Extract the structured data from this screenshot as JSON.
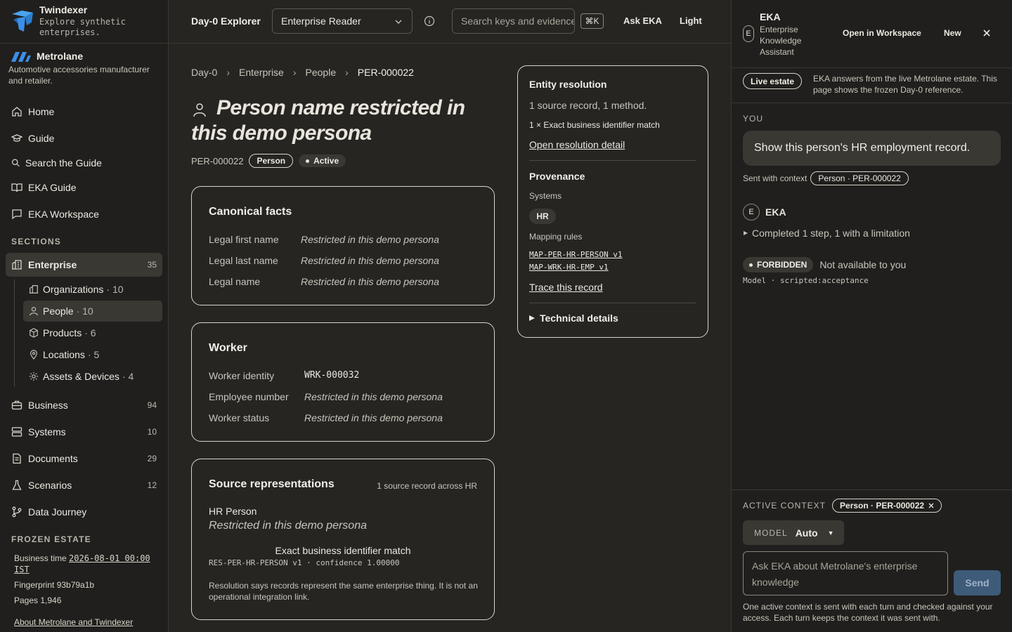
{
  "brand": {
    "name": "Twindexer",
    "tagline": "Explore synthetic enterprises."
  },
  "org": {
    "name": "Metrolane",
    "description": "Automotive accessories manufacturer and retailer."
  },
  "nav": {
    "home": "Home",
    "guide": "Guide",
    "search_guide": "Search the Guide",
    "eka_guide": "EKA Guide",
    "eka_workspace": "EKA Workspace"
  },
  "sections_heading": "SECTIONS",
  "sections": {
    "enterprise": {
      "label": "Enterprise",
      "count": "35"
    },
    "business": {
      "label": "Business",
      "count": "94"
    },
    "systems": {
      "label": "Systems",
      "count": "10"
    },
    "documents": {
      "label": "Documents",
      "count": "29"
    },
    "scenarios": {
      "label": "Scenarios",
      "count": "12"
    },
    "data_journey": {
      "label": "Data Journey"
    }
  },
  "enterprise_sub": [
    {
      "label": "Organizations",
      "count": "· 10"
    },
    {
      "label": "People",
      "count": "· 10"
    },
    {
      "label": "Products",
      "count": "· 6"
    },
    {
      "label": "Locations",
      "count": "· 5"
    },
    {
      "label": "Assets & Devices",
      "count": "· 4"
    }
  ],
  "frozen": {
    "heading": "FROZEN ESTATE",
    "business_time_label": "Business time",
    "business_time": "2026-08-01 00:00 IST",
    "fingerprint": "Fingerprint 93b79a1b",
    "pages": "Pages 1,946",
    "about": "About Metrolane and Twindexer"
  },
  "topbar": {
    "title": "Day-0 Explorer",
    "persona": "Enterprise Reader",
    "search_placeholder": "Search keys and evidence",
    "shortcut": "⌘K",
    "ask": "Ask EKA",
    "theme": "Light"
  },
  "breadcrumb": [
    "Day-0",
    "Enterprise",
    "People",
    "PER-000022"
  ],
  "entity": {
    "title": "Person name restricted in this demo persona",
    "id": "PER-000022",
    "type": "Person",
    "status": "Active"
  },
  "canonical": {
    "heading": "Canonical facts",
    "rows": [
      {
        "k": "Legal first name",
        "v": "Restricted in this demo persona"
      },
      {
        "k": "Legal last name",
        "v": "Restricted in this demo persona"
      },
      {
        "k": "Legal name",
        "v": "Restricted in this demo persona"
      }
    ]
  },
  "worker": {
    "heading": "Worker",
    "rows": [
      {
        "k": "Worker identity",
        "v": "WRK-000032"
      },
      {
        "k": "Employee number",
        "v": "Restricted in this demo persona"
      },
      {
        "k": "Worker status",
        "v": "Restricted in this demo persona"
      }
    ]
  },
  "sources": {
    "heading": "Source representations",
    "summary": "1 source record across HR",
    "system_label": "HR Person",
    "value": "Restricted in this demo persona",
    "match": "Exact business identifier match",
    "rule": "RES-PER-HR-PERSON v1 · confidence 1.00000",
    "note": "Resolution says records represent the same enterprise thing. It is not an operational integration link."
  },
  "resolution": {
    "heading": "Entity resolution",
    "summary": "1 source record, 1 method.",
    "method": "1 × Exact business identifier match",
    "link": "Open resolution detail"
  },
  "provenance": {
    "heading": "Provenance",
    "systems_label": "Systems",
    "system": "HR",
    "rules_label": "Mapping rules",
    "rules": [
      "MAP-PER-HR-PERSON v1",
      "MAP-WRK-HR-EMP v1"
    ],
    "trace": "Trace this record",
    "technical": "Technical details"
  },
  "eka": {
    "badge": "E",
    "name": "EKA",
    "subtitle": "Enterprise Knowledge Assistant",
    "open_workspace": "Open in Workspace",
    "new": "New",
    "live_pill": "Live estate",
    "live_note": "EKA answers from the live Metrolane estate. This page shows the frozen Day-0 reference.",
    "you_label": "YOU",
    "user_message": "Show this person's HR employment record.",
    "sent_with": "Sent with context",
    "context": "Person · PER-000022",
    "reply_author": "EKA",
    "steps": "Completed 1 step, 1 with a limitation",
    "forbidden": "FORBIDDEN",
    "forbidden_msg": "Not available to you",
    "model_line": "Model · scripted:acceptance",
    "active_context_label": "ACTIVE CONTEXT",
    "model_label": "MODEL",
    "model_value": "Auto",
    "composer_placeholder": "Ask EKA about Metrolane's enterprise knowledge",
    "send": "Send",
    "footer": "One active context is sent with each turn and checked against your access. Each turn keeps the context it was sent with."
  },
  "colors": {
    "background": "#262522",
    "sidebar": "#201f1d",
    "brand_blue": "#3b8fe8",
    "send_button": "#3e5b7a"
  }
}
